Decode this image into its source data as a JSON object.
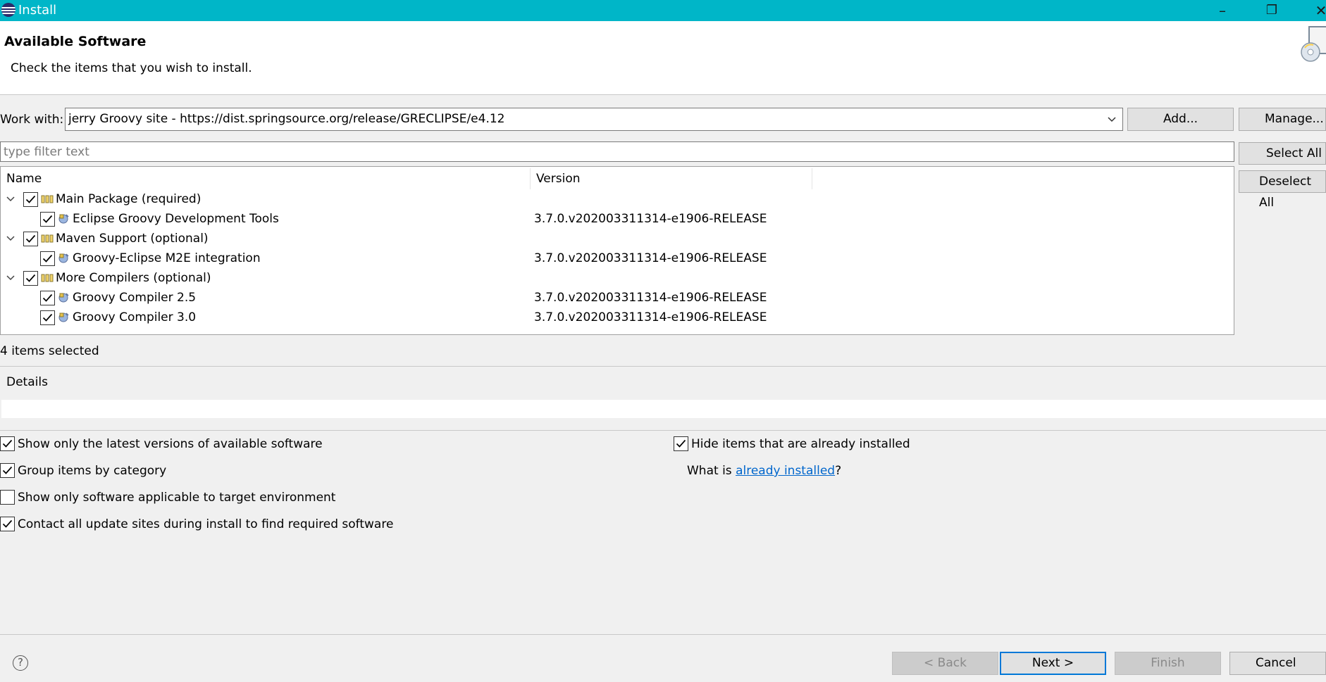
{
  "window": {
    "title": "Install"
  },
  "header": {
    "title": "Available Software",
    "description": "Check the items that you wish to install."
  },
  "work_with": {
    "label": "Work with:",
    "value": "jerry Groovy site - https://dist.springsource.org/release/GRECLIPSE/e4.12",
    "add_label": "Add...",
    "manage_label": "Manage..."
  },
  "filter": {
    "placeholder": "type filter text"
  },
  "side_buttons": {
    "select_all": "Select All",
    "deselect_all": "Deselect All"
  },
  "tree": {
    "columns": [
      "Name",
      "Version"
    ],
    "rows": [
      {
        "name": "Main Package (required)",
        "version": "",
        "level": 0,
        "checked": true
      },
      {
        "name": "Eclipse Groovy Development Tools",
        "version": "3.7.0.v202003311314-e1906-RELEASE",
        "level": 1,
        "checked": true
      },
      {
        "name": "Maven Support (optional)",
        "version": "",
        "level": 0,
        "checked": true
      },
      {
        "name": "Groovy-Eclipse M2E integration",
        "version": "3.7.0.v202003311314-e1906-RELEASE",
        "level": 1,
        "checked": true
      },
      {
        "name": "More Compilers (optional)",
        "version": "",
        "level": 0,
        "checked": true
      },
      {
        "name": "Groovy Compiler 2.5",
        "version": "3.7.0.v202003311314-e1906-RELEASE",
        "level": 1,
        "checked": true
      },
      {
        "name": "Groovy Compiler 3.0",
        "version": "3.7.0.v202003311314-e1906-RELEASE",
        "level": 1,
        "checked": true
      }
    ]
  },
  "selection_count": "4 items selected",
  "details": {
    "label": "Details",
    "text": ""
  },
  "options": {
    "latest_versions": {
      "label": "Show only the latest versions of available software",
      "checked": true
    },
    "group_by_category": {
      "label": "Group items by category",
      "checked": true
    },
    "target_env": {
      "label": "Show only software applicable to target environment",
      "checked": false
    },
    "contact_sites": {
      "label": "Contact all update sites during install to find required software",
      "checked": true
    },
    "hide_installed": {
      "label": "Hide items that are already installed",
      "checked": true
    }
  },
  "installed_link": {
    "prefix": "What is ",
    "link": "already installed",
    "suffix": "?"
  },
  "footer": {
    "back": "< Back",
    "next": "Next >",
    "finish": "Finish",
    "cancel": "Cancel"
  },
  "icons": {
    "app": "eclipse-icon",
    "help": "help-icon",
    "category": "category-icon",
    "feature": "feature-icon"
  },
  "colors": {
    "titlebar": "#00b6c8",
    "link": "#0066cc",
    "default_button_border": "#0078d7"
  }
}
